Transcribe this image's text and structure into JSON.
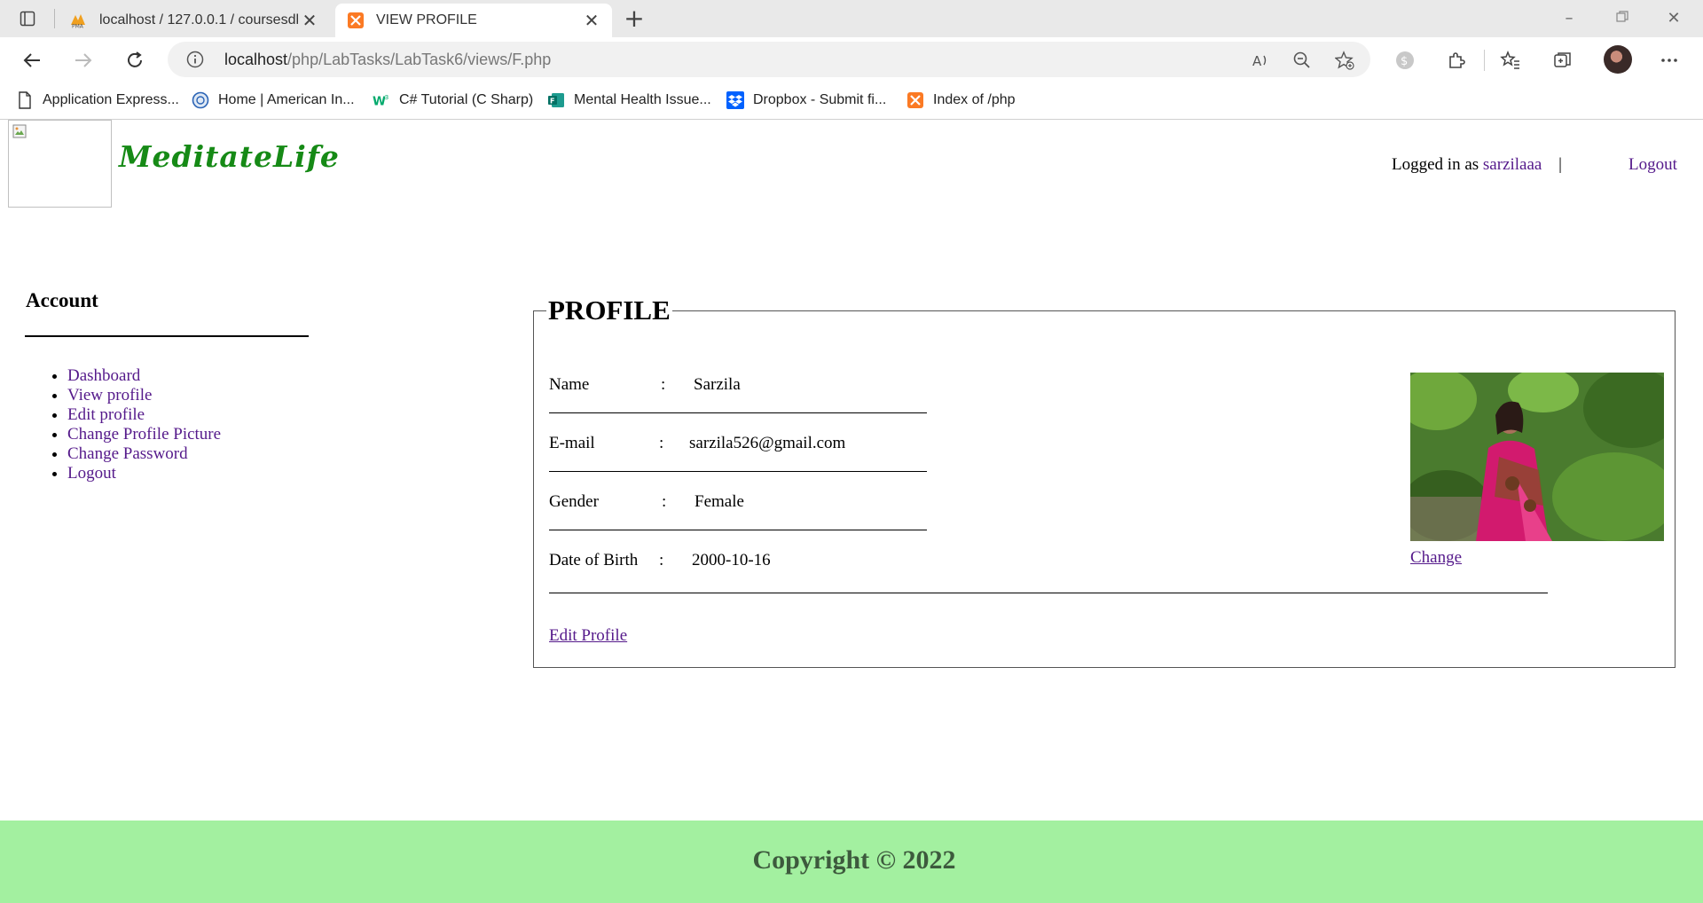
{
  "browser": {
    "tabs": [
      {
        "title": "localhost / 127.0.0.1 / coursesdb",
        "icon": "phpmyadmin-icon"
      },
      {
        "title": "VIEW PROFILE",
        "icon": "xampp-icon"
      }
    ],
    "url_host": "localhost",
    "url_path": "/php/LabTasks/LabTask6/views/F.php",
    "bookmarks": [
      {
        "label": "Application Express...",
        "icon": "page-icon"
      },
      {
        "label": "Home | American In...",
        "icon": "globe-icon"
      },
      {
        "label": "C# Tutorial (C Sharp)",
        "icon": "w3schools-icon"
      },
      {
        "label": "Mental Health Issue...",
        "icon": "forms-icon"
      },
      {
        "label": "Dropbox - Submit fi...",
        "icon": "dropbox-icon"
      },
      {
        "label": "Index of /php",
        "icon": "xampp-icon"
      }
    ]
  },
  "header": {
    "brand": "MeditateLife",
    "logged_in_prefix": "Logged in as",
    "username": "sarzilaaa",
    "separator": "|",
    "logout": "Logout"
  },
  "sidebar": {
    "title": "Account",
    "items": [
      {
        "label": "Dashboard"
      },
      {
        "label": "View profile"
      },
      {
        "label": "Edit profile"
      },
      {
        "label": "Change Profile Picture"
      },
      {
        "label": "Change Password"
      },
      {
        "label": "Logout"
      }
    ]
  },
  "profile": {
    "legend": "PROFILE",
    "fields": [
      {
        "label": "Name",
        "colon": ":",
        "value": "Sarzila"
      },
      {
        "label": "E-mail",
        "colon": ":",
        "value": "sarzila526@gmail.com"
      },
      {
        "label": "Gender",
        "colon": ":",
        "value": "Female"
      },
      {
        "label": "Date of Birth",
        "colon": ":",
        "value": "2000-10-16"
      }
    ],
    "change_link": "Change",
    "edit_link": "Edit Profile"
  },
  "footer": {
    "copyright": "Copyright © 2022"
  },
  "colors": {
    "brand": "#168a16",
    "link": "#551a8b",
    "footer_bg": "#a3f0a0"
  }
}
